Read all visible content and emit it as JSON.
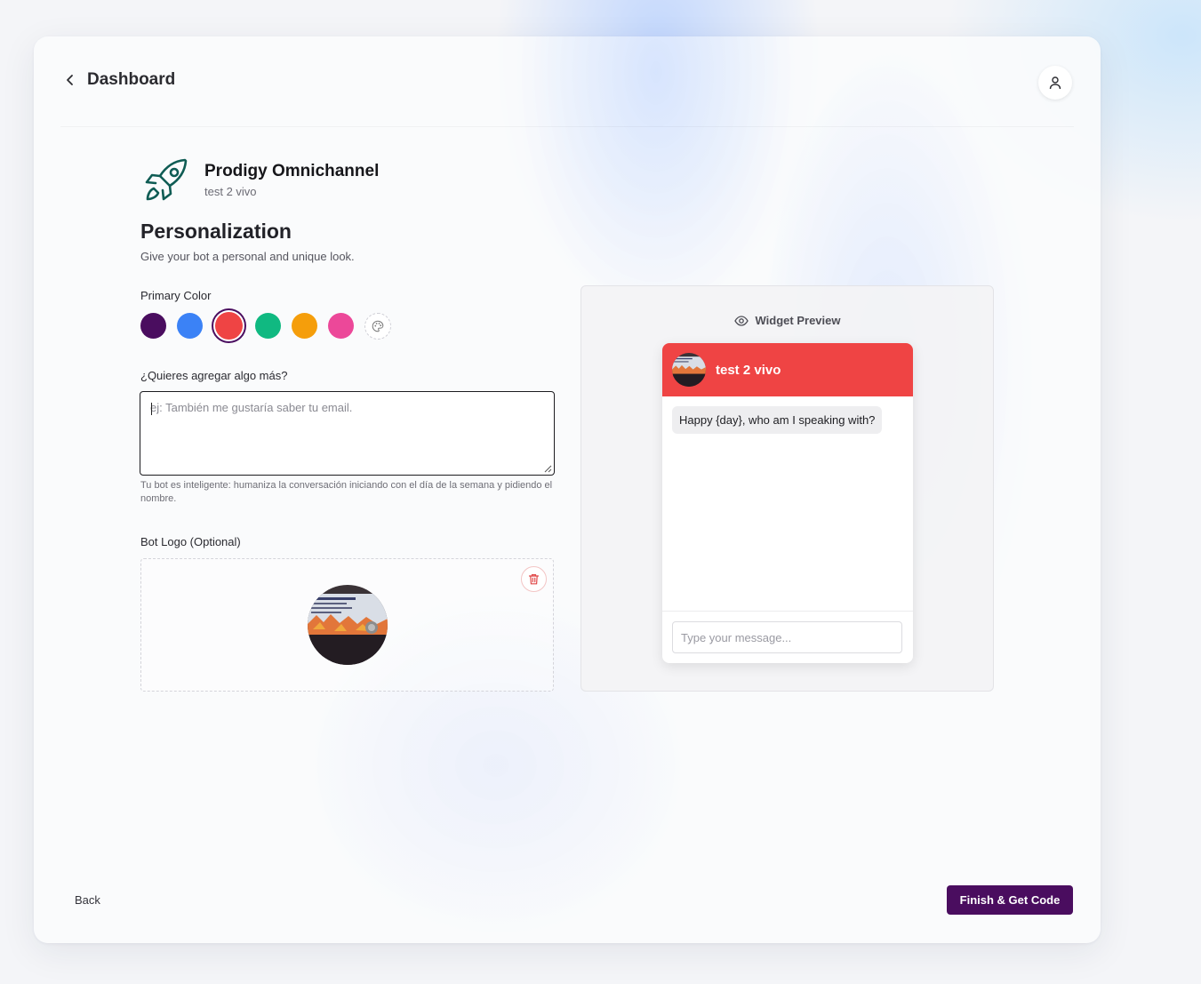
{
  "header": {
    "back_label": "Dashboard"
  },
  "bot": {
    "name": "Prodigy Omnichannel",
    "subtitle": "test 2 vivo"
  },
  "personalization": {
    "title": "Personalization",
    "description": "Give your bot a personal and unique look."
  },
  "primary_color": {
    "label": "Primary Color",
    "options": [
      "#4a0d5f",
      "#3b82f6",
      "#ef4444",
      "#10b981",
      "#f59e0b",
      "#ec4899"
    ],
    "selected": "#ef4444"
  },
  "extra": {
    "label": "¿Quieres agregar algo más?",
    "placeholder": "ej: También me gustaría saber tu email.",
    "value": "",
    "helper": "Tu bot es inteligente: humaniza la conversación iniciando con el día de la semana y pidiendo el nombre."
  },
  "bot_logo": {
    "label": "Bot Logo (Optional)"
  },
  "preview": {
    "title": "Widget Preview",
    "bot_name": "test 2 vivo",
    "greeting": "Happy {day}, who am I speaking with?",
    "input_placeholder": "Type your message..."
  },
  "footer": {
    "back_label": "Back",
    "finish_label": "Finish & Get Code",
    "finish_color": "#4a0d5f"
  },
  "icons": {
    "back": "chevron-left-icon",
    "user": "user-icon",
    "brand": "rocket-icon",
    "custom_color": "palette-icon",
    "delete": "trash-icon",
    "preview": "eye-icon"
  }
}
